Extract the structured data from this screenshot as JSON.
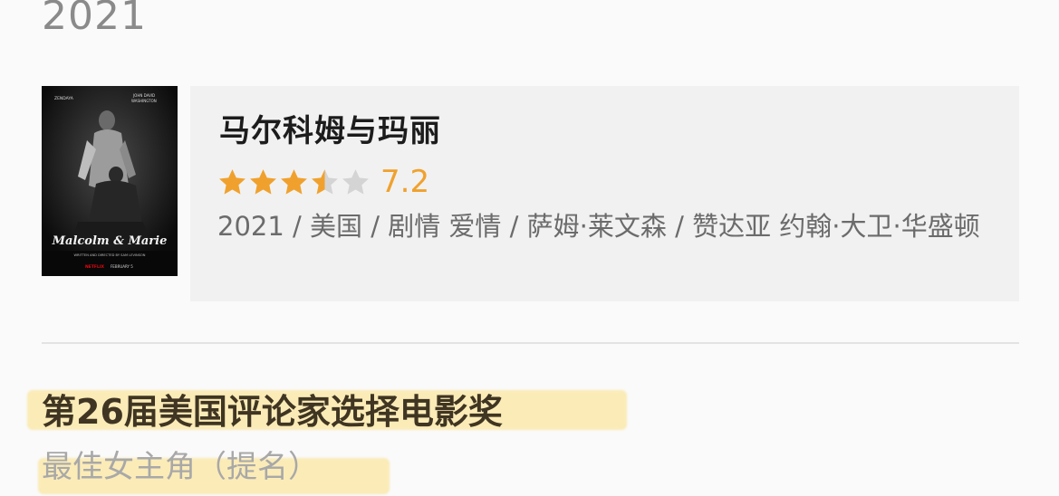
{
  "year_header": "2021",
  "movie": {
    "title": "马尔科姆与玛丽",
    "rating": {
      "value_text": "7.2",
      "stars_filled": 3.5,
      "stars_total": 5,
      "filled_color": "#f0a12d",
      "empty_color": "#d4d4d4"
    },
    "meta": "2021 / 美国 / 剧情 爱情 / 萨姆·莱文森 / 赞达亚 约翰·大卫·华盛顿",
    "poster": {
      "actor_left": "ZENDAYA",
      "actor_right_line1": "JOHN DAVID",
      "actor_right_line2": "WASHINGTON",
      "title": "Malcolm & Marie",
      "credit": "WRITTEN AND DIRECTED BY SAM LEVINSON",
      "studio": "NETFLIX",
      "release": "FEBRUARY 5"
    }
  },
  "award": {
    "name": "第26届美国评论家选择电影奖",
    "category": "最佳女主角（提名）",
    "highlight_color": "#fae7aa"
  }
}
